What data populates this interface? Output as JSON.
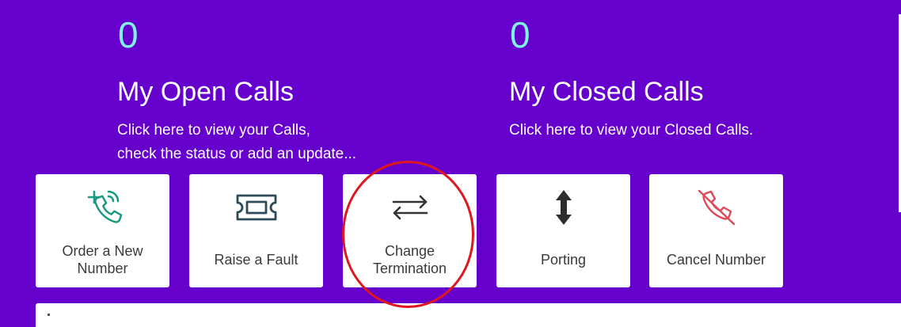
{
  "open_calls": {
    "count": "0",
    "title": "My Open Calls",
    "desc_line1": "Click here to view your Calls,",
    "desc_line2": "check the status or add an update..."
  },
  "closed_calls": {
    "count": "0",
    "title": "My Closed Calls",
    "desc_line1": "Click here to view your Closed Calls."
  },
  "tiles": [
    {
      "icon": "phone-plus-icon",
      "label": "Order a New Number"
    },
    {
      "icon": "ticket-icon",
      "label": "Raise a Fault"
    },
    {
      "icon": "swap-arrows-icon",
      "label": "Change Termination"
    },
    {
      "icon": "vertical-arrows-icon",
      "label": "Porting"
    },
    {
      "icon": "phone-cancel-icon",
      "label": "Cancel Number"
    }
  ],
  "colors": {
    "background": "#6600cc",
    "count": "#7ff3e8",
    "teal_icon": "#1a9a82",
    "dark_icon": "#3a3a3a",
    "slate_icon": "#2c4a5a",
    "red_icon": "#e0485a",
    "annotation": "#e0161f"
  }
}
